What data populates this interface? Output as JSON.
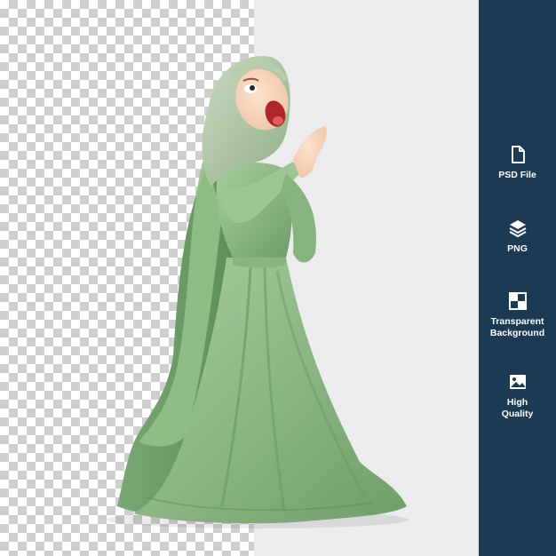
{
  "sidebar": {
    "features": [
      {
        "icon": "document-icon",
        "label": "PSD File"
      },
      {
        "icon": "layers-icon",
        "label": "PNG"
      },
      {
        "icon": "checkerboard-icon",
        "label": "Transparent\nBackground"
      },
      {
        "icon": "image-icon",
        "label": "High\nQuality"
      }
    ]
  },
  "colors": {
    "sidebar_bg": "#1d3a55",
    "robe_green": "#8fbb86",
    "backdrop": "#ececee"
  }
}
